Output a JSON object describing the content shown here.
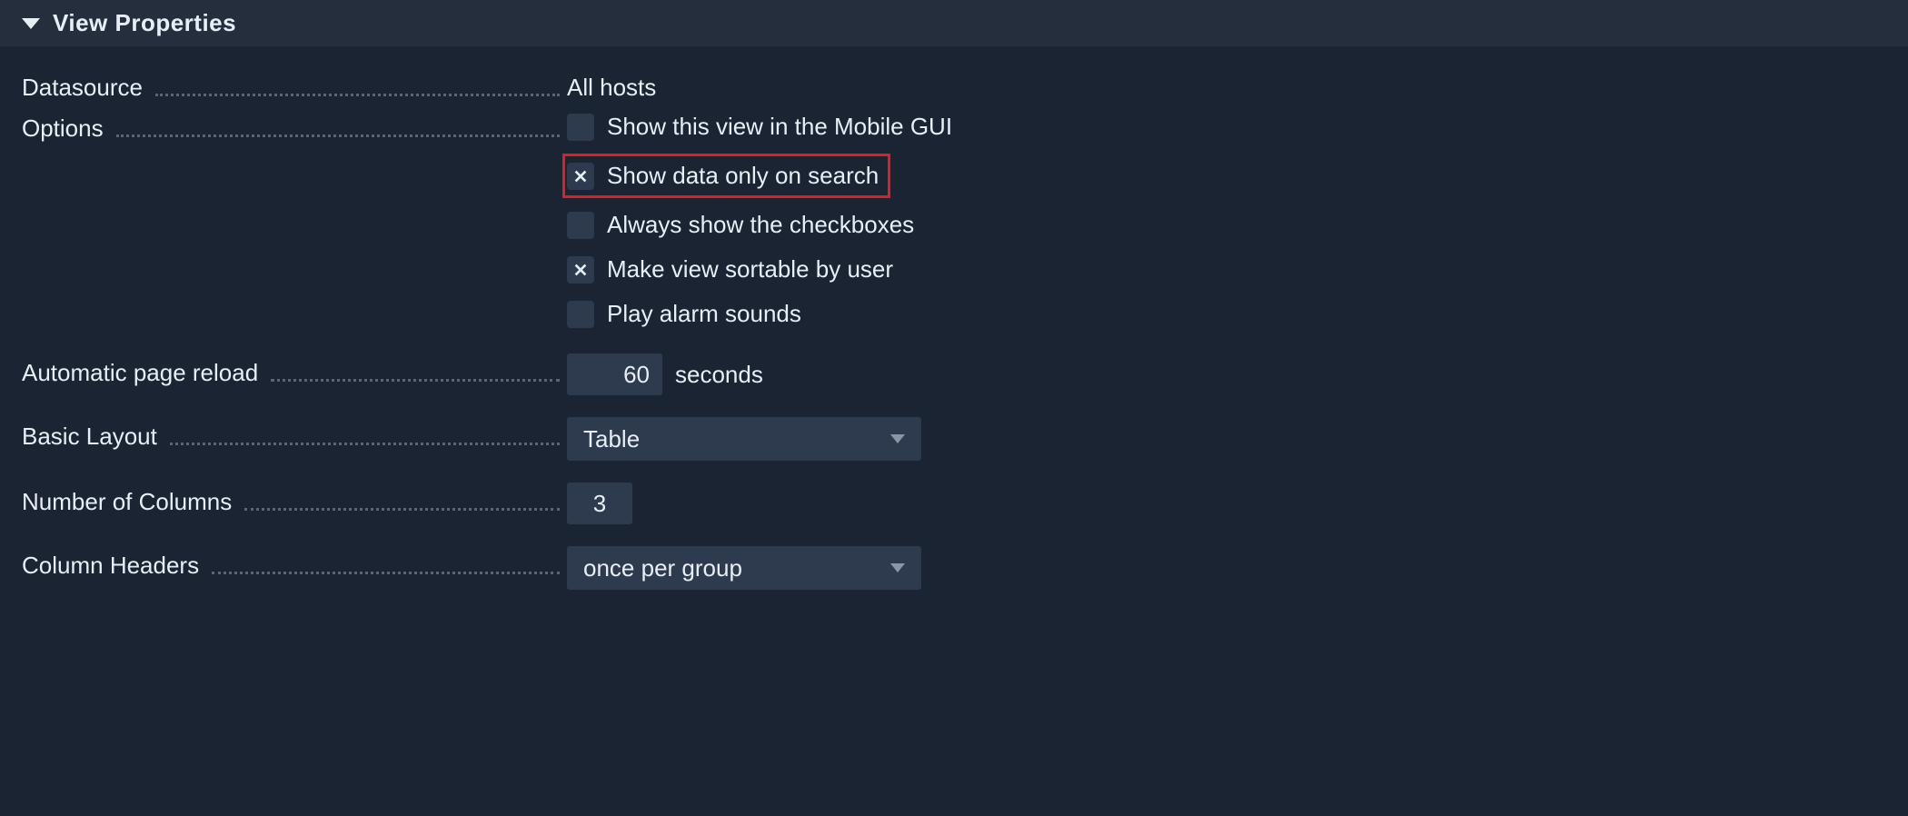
{
  "header": {
    "title": "View Properties"
  },
  "datasource": {
    "label": "Datasource",
    "value": "All hosts"
  },
  "options": {
    "label": "Options",
    "items": [
      {
        "label": "Show this view in the Mobile GUI",
        "checked": false,
        "highlight": false
      },
      {
        "label": "Show data only on search",
        "checked": true,
        "highlight": true
      },
      {
        "label": "Always show the checkboxes",
        "checked": false,
        "highlight": false
      },
      {
        "label": "Make view sortable by user",
        "checked": true,
        "highlight": false
      },
      {
        "label": "Play alarm sounds",
        "checked": false,
        "highlight": false
      }
    ]
  },
  "reload": {
    "label": "Automatic page reload",
    "value": "60",
    "unit": "seconds"
  },
  "layout": {
    "label": "Basic Layout",
    "value": "Table"
  },
  "columns": {
    "label": "Number of Columns",
    "value": "3"
  },
  "headers": {
    "label": "Column Headers",
    "value": "once per group"
  }
}
